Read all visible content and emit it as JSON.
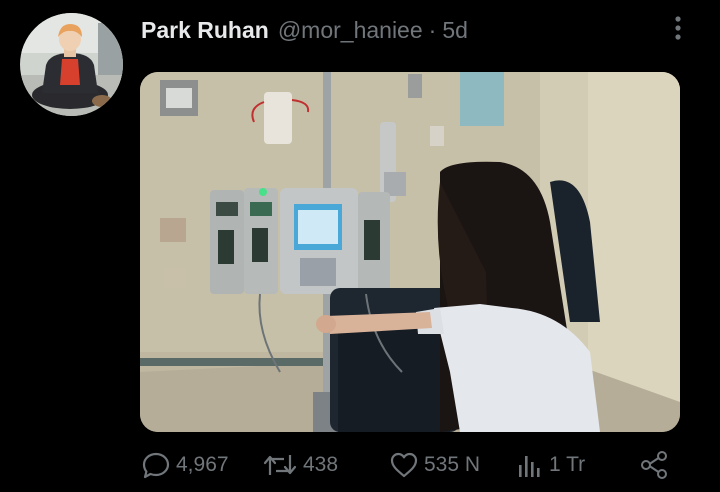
{
  "tweet": {
    "author": {
      "display_name": "Park Ruhan",
      "handle": "@mor_haniee",
      "avatar_icon": "avatar-photo"
    },
    "separator": "·",
    "time": "5d",
    "more_icon": "more-vertical-icon",
    "media": {
      "type": "photo"
    },
    "actions": {
      "reply": {
        "icon": "reply-icon",
        "count": "4,967"
      },
      "retweet": {
        "icon": "retweet-icon",
        "count": "438"
      },
      "like": {
        "icon": "heart-icon",
        "count": "535 N"
      },
      "views": {
        "icon": "views-icon",
        "count": "1 Tr"
      },
      "share": {
        "icon": "share-icon"
      }
    }
  },
  "colors": {
    "background": "#000000",
    "primary_text": "#e7e9ea",
    "secondary_text": "#71767b"
  }
}
